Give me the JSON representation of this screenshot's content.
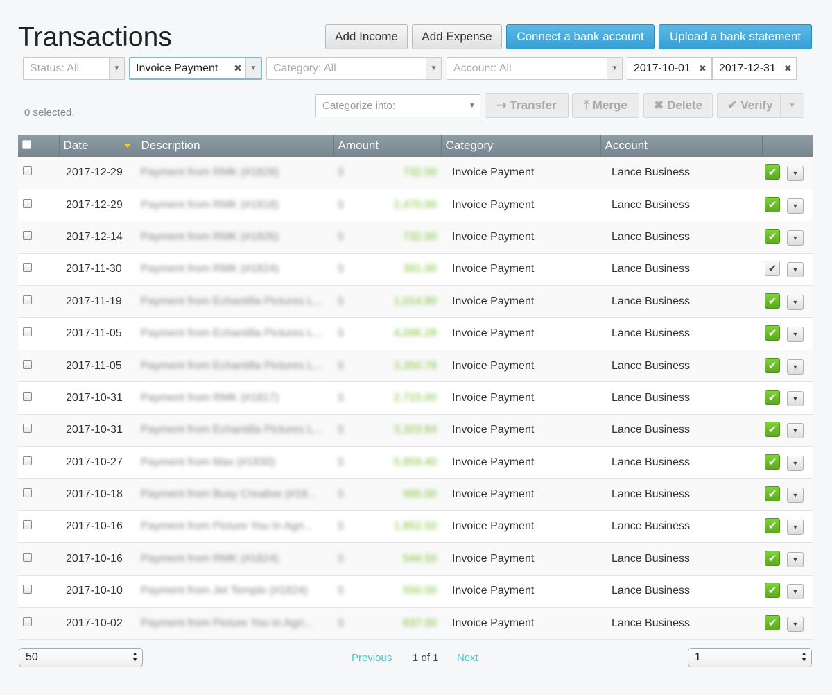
{
  "header": {
    "title": "Transactions",
    "actions": {
      "add_income": "Add Income",
      "add_expense": "Add Expense",
      "connect_bank": "Connect a bank account",
      "upload_statement": "Upload a bank statement"
    }
  },
  "filters": {
    "status": "Status: All",
    "type": "Invoice Payment",
    "category": "Category: All",
    "account": "Account: All",
    "date_from": "2017-10-01",
    "date_to": "2017-12-31"
  },
  "bulk": {
    "selected_count": "0 selected.",
    "categorize_placeholder": "Categorize into:",
    "transfer": "Transfer",
    "merge": "Merge",
    "delete": "Delete",
    "verify": "Verify"
  },
  "table": {
    "columns": {
      "date": "Date",
      "description": "Description",
      "amount": "Amount",
      "category": "Category",
      "account": "Account"
    },
    "rows": [
      {
        "date": "2017-12-29",
        "description": "Payment from RMK (#1828)",
        "currency": "$",
        "amount": "732.00",
        "category": "Invoice Payment",
        "account": "Lance Business",
        "verified": true
      },
      {
        "date": "2017-12-29",
        "description": "Payment from RMK (#1818)",
        "currency": "$",
        "amount": "2,470.00",
        "category": "Invoice Payment",
        "account": "Lance Business",
        "verified": true
      },
      {
        "date": "2017-12-14",
        "description": "Payment from RMK (#1826)",
        "currency": "$",
        "amount": "732.00",
        "category": "Invoice Payment",
        "account": "Lance Business",
        "verified": true
      },
      {
        "date": "2017-11-30",
        "description": "Payment from RMK (#1824)",
        "currency": "$",
        "amount": "391.00",
        "category": "Invoice Payment",
        "account": "Lance Business",
        "verified": false
      },
      {
        "date": "2017-11-19",
        "description": "Payment from Echantilla Pictures L...",
        "currency": "$",
        "amount": "1,014.80",
        "category": "Invoice Payment",
        "account": "Lance Business",
        "verified": true
      },
      {
        "date": "2017-11-05",
        "description": "Payment from Echantilla Pictures L...",
        "currency": "$",
        "amount": "4,096.28",
        "category": "Invoice Payment",
        "account": "Lance Business",
        "verified": true
      },
      {
        "date": "2017-11-05",
        "description": "Payment from Echantilla Pictures L...",
        "currency": "$",
        "amount": "3,350.78",
        "category": "Invoice Payment",
        "account": "Lance Business",
        "verified": true
      },
      {
        "date": "2017-10-31",
        "description": "Payment from RMK (#1817)",
        "currency": "$",
        "amount": "2,715.00",
        "category": "Invoice Payment",
        "account": "Lance Business",
        "verified": true
      },
      {
        "date": "2017-10-31",
        "description": "Payment from Echantilla Pictures L...",
        "currency": "$",
        "amount": "3,323.84",
        "category": "Invoice Payment",
        "account": "Lance Business",
        "verified": true
      },
      {
        "date": "2017-10-27",
        "description": "Payment from Max (#1830)",
        "currency": "$",
        "amount": "5,859.40",
        "category": "Invoice Payment",
        "account": "Lance Business",
        "verified": true
      },
      {
        "date": "2017-10-18",
        "description": "Payment from Busy Creative (#18...",
        "currency": "$",
        "amount": "995.00",
        "category": "Invoice Payment",
        "account": "Lance Business",
        "verified": true
      },
      {
        "date": "2017-10-16",
        "description": "Payment from Picture You In Agri...",
        "currency": "$",
        "amount": "1,852.50",
        "category": "Invoice Payment",
        "account": "Lance Business",
        "verified": true
      },
      {
        "date": "2017-10-16",
        "description": "Payment from RMK (#1824)",
        "currency": "$",
        "amount": "544.50",
        "category": "Invoice Payment",
        "account": "Lance Business",
        "verified": true
      },
      {
        "date": "2017-10-10",
        "description": "Payment from Jet Temple (#1824)",
        "currency": "$",
        "amount": "550.00",
        "category": "Invoice Payment",
        "account": "Lance Business",
        "verified": true
      },
      {
        "date": "2017-10-02",
        "description": "Payment from Picture You In Agri...",
        "currency": "$",
        "amount": "837.00",
        "category": "Invoice Payment",
        "account": "Lance Business",
        "verified": true
      }
    ]
  },
  "pagination": {
    "per_page": "50",
    "previous": "Previous",
    "page_info": "1 of 1",
    "next": "Next",
    "page": "1"
  }
}
